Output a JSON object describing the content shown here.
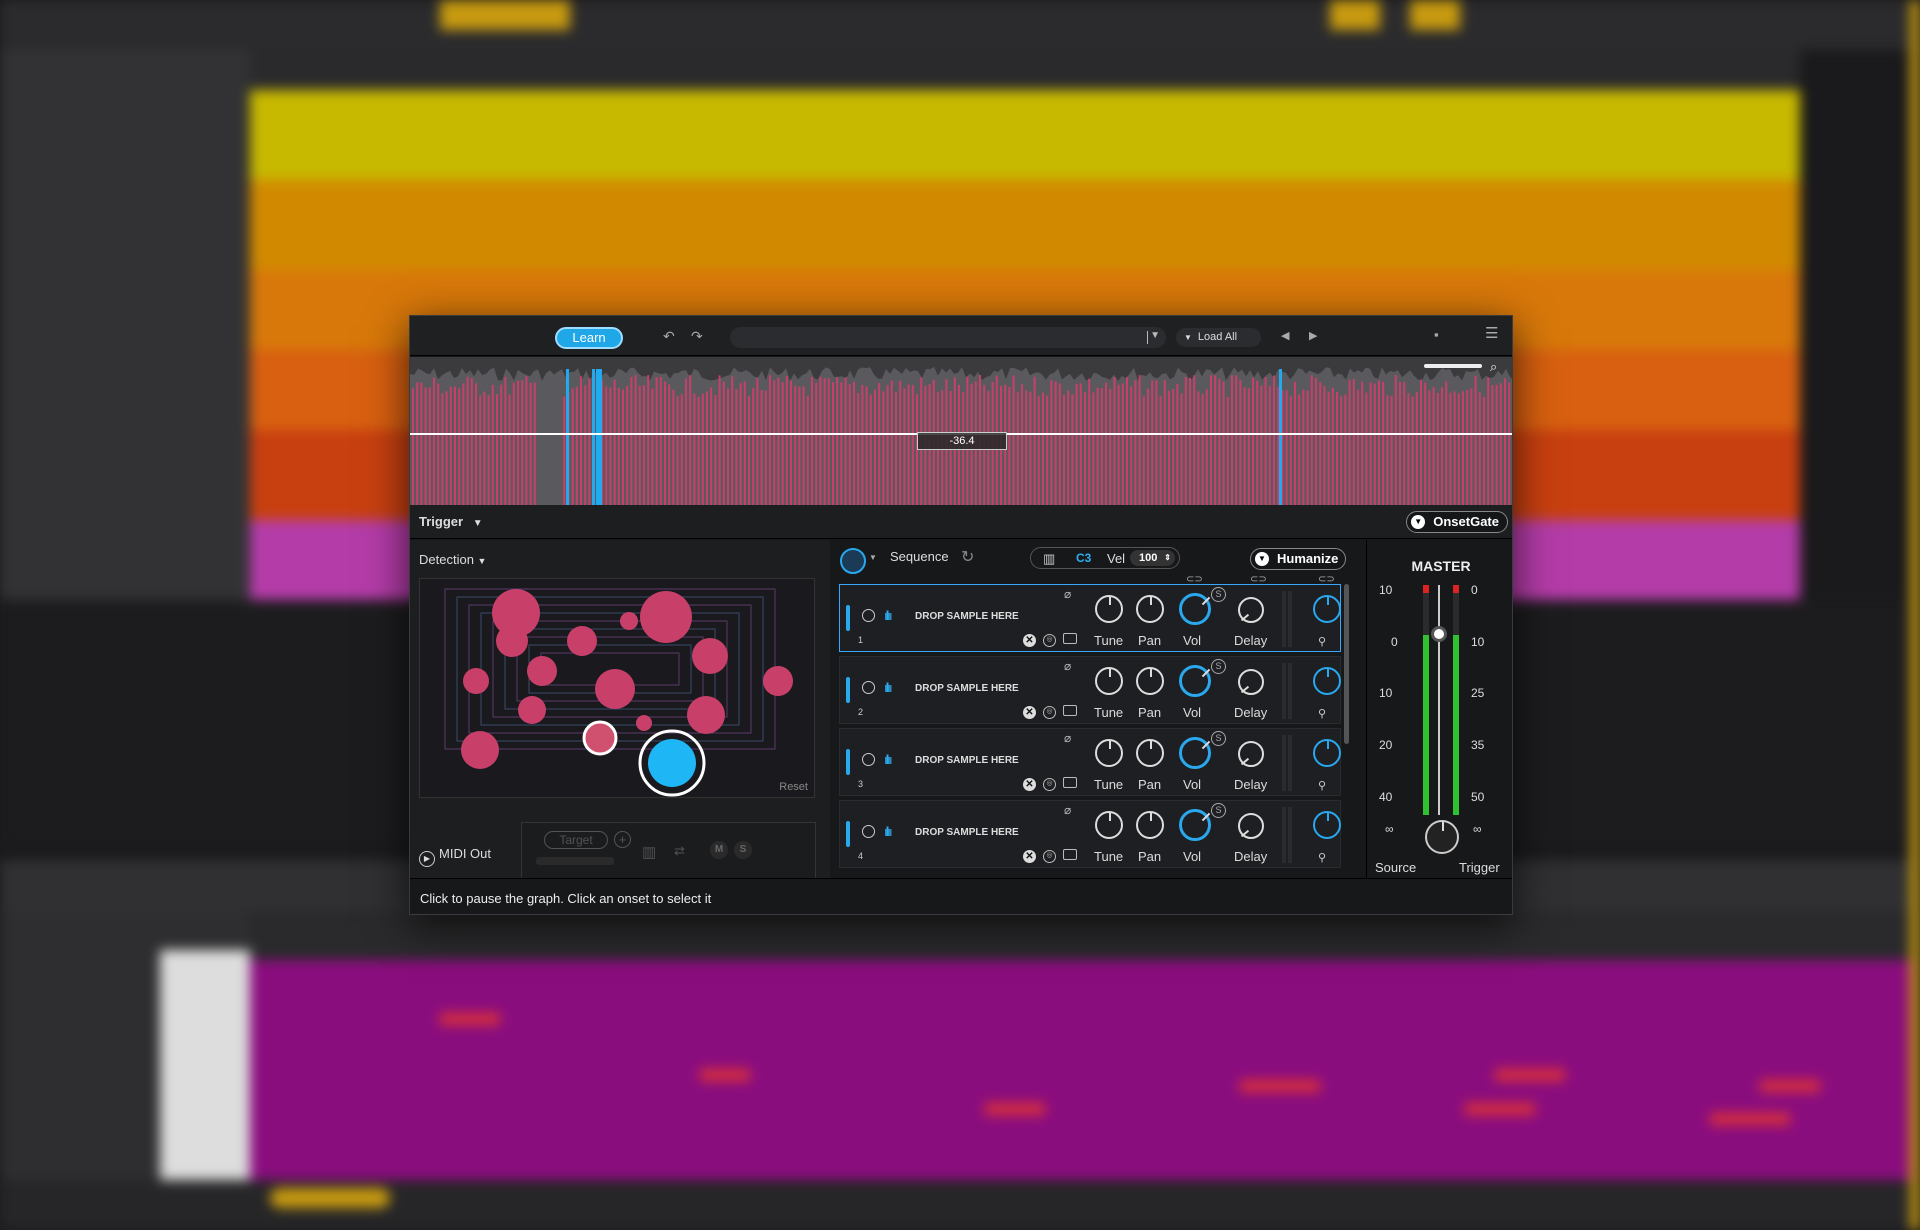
{
  "topbar": {
    "learn_label": "Learn",
    "undo_icon": "undo-icon",
    "redo_icon": "redo-icon",
    "preset_value": "",
    "load_all_label": "Load All",
    "prev_icon": "triangle-left-icon",
    "next_icon": "triangle-right-icon",
    "save_icon": "save-icon",
    "menu_icon": "hamburger-icon"
  },
  "waveform": {
    "threshold_value": "-36.4",
    "accent_color": "#c8406a",
    "onset_color": "#22aaee"
  },
  "trigger_bar": {
    "trigger_label": "Trigger",
    "module_label": "OnsetGate"
  },
  "detection": {
    "label": "Detection",
    "reset_label": "Reset",
    "midi_out_label": "MIDI Out",
    "target_label": "Target",
    "mute_label": "M",
    "solo_label": "S"
  },
  "sequence": {
    "label": "Sequence",
    "note": "C3",
    "vel_label": "Vel",
    "vel_value": "100",
    "humanize_label": "Humanize"
  },
  "samples": [
    {
      "num": "1",
      "drop": "DROP SAMPLE HERE",
      "tune": "Tune",
      "pan": "Pan",
      "vol": "Vol",
      "delay": "Delay",
      "s": "S"
    },
    {
      "num": "2",
      "drop": "DROP SAMPLE HERE",
      "tune": "Tune",
      "pan": "Pan",
      "vol": "Vol",
      "delay": "Delay",
      "s": "S"
    },
    {
      "num": "3",
      "drop": "DROP SAMPLE HERE",
      "tune": "Tune",
      "pan": "Pan",
      "vol": "Vol",
      "delay": "Delay",
      "s": "S"
    },
    {
      "num": "4",
      "drop": "DROP SAMPLE HERE",
      "tune": "Tune",
      "pan": "Pan",
      "vol": "Vol",
      "delay": "Delay",
      "s": "S"
    }
  ],
  "master": {
    "title": "MASTER",
    "left_scale": [
      "10",
      "0",
      "10",
      "20",
      "40",
      "∞"
    ],
    "right_scale": [
      "0",
      "10",
      "25",
      "35",
      "50",
      "∞"
    ],
    "source_label": "Source",
    "trigger_label": "Trigger"
  },
  "status": {
    "text": "Click to pause the graph. Click an onset to select it"
  }
}
